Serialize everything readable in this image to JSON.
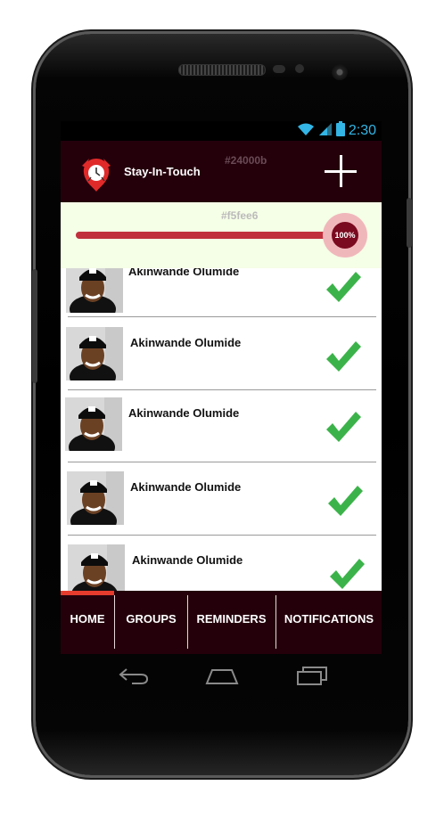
{
  "statusbar": {
    "time": "2:30",
    "icons": [
      "wifi-icon",
      "signal-icon",
      "battery-icon"
    ]
  },
  "header": {
    "title": "Stay-In-Touch",
    "color_note": "#24000b",
    "add_icon": "plus-icon",
    "background": "#24000b"
  },
  "progress": {
    "color_note": "#f5fee6",
    "value_label": "100%",
    "fraction": 1.0,
    "fill_color": "#c0303d",
    "background": "#f5fee6"
  },
  "contacts": [
    {
      "name": "Akinwande Olumide",
      "status_icon": "check-icon"
    },
    {
      "name": "Akinwande Olumide",
      "status_icon": "check-icon"
    },
    {
      "name": "Akinwande Olumide",
      "status_icon": "check-icon"
    },
    {
      "name": "Akinwande Olumide",
      "status_icon": "check-icon"
    },
    {
      "name": "Akinwande Olumide",
      "status_icon": "check-icon"
    }
  ],
  "tabs": [
    {
      "label": "HOME",
      "active": true
    },
    {
      "label": "GROUPS",
      "active": false
    },
    {
      "label": "REMINDERS",
      "active": false
    },
    {
      "label": "NOTIFICATIONS",
      "active": false
    }
  ],
  "nav": [
    "back-icon",
    "home-icon",
    "recent-apps-icon"
  ],
  "colors": {
    "check": "#3cb34a",
    "tab_indicator": "#e63c2e"
  }
}
